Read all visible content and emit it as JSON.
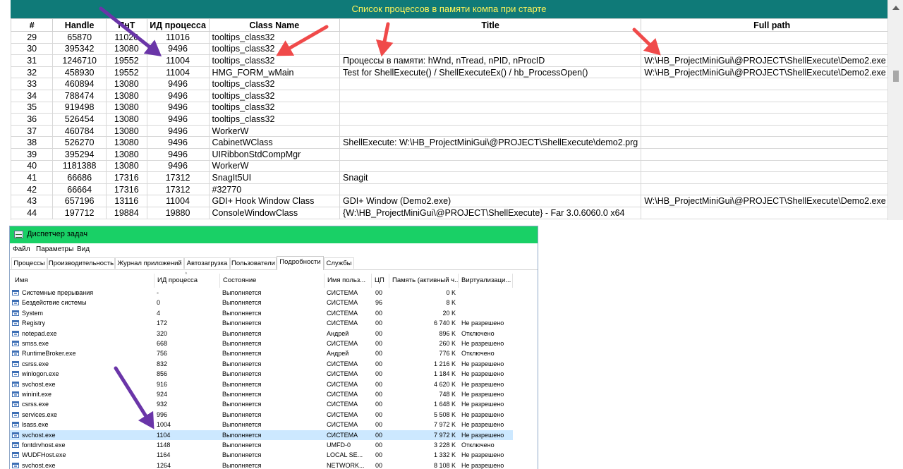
{
  "process_list": {
    "title": "Список процессов в памяти компа при старте",
    "headers": [
      "#",
      "Handle",
      "ПнТ",
      "ИД процесса",
      "Class Name",
      "Title",
      "Full path"
    ],
    "rows": [
      [
        "29",
        "65870",
        "11020",
        "11016",
        "tooltips_class32",
        "",
        ""
      ],
      [
        "30",
        "395342",
        "13080",
        "9496",
        "tooltips_class32",
        "",
        ""
      ],
      [
        "31",
        "1246710",
        "19552",
        "11004",
        "tooltips_class32",
        "Процессы в памяти: hWnd, nTread, nPID, nProcID",
        "W:\\HB_ProjectMiniGui\\@PROJECT\\ShellExecute\\Demo2.exe"
      ],
      [
        "32",
        "458930",
        "19552",
        "11004",
        "HMG_FORM_wMain",
        "Test for ShellExecute() / ShellExecuteEx() / hb_ProcessOpen()",
        "W:\\HB_ProjectMiniGui\\@PROJECT\\ShellExecute\\Demo2.exe"
      ],
      [
        "33",
        "460894",
        "13080",
        "9496",
        "tooltips_class32",
        "",
        ""
      ],
      [
        "34",
        "788474",
        "13080",
        "9496",
        "tooltips_class32",
        "",
        ""
      ],
      [
        "35",
        "919498",
        "13080",
        "9496",
        "tooltips_class32",
        "",
        ""
      ],
      [
        "36",
        "526454",
        "13080",
        "9496",
        "tooltips_class32",
        "",
        ""
      ],
      [
        "37",
        "460784",
        "13080",
        "9496",
        "WorkerW",
        "",
        ""
      ],
      [
        "38",
        "526270",
        "13080",
        "9496",
        "CabinetWClass",
        "ShellExecute: W:\\HB_ProjectMiniGui\\@PROJECT\\ShellExecute\\demo2.prg",
        ""
      ],
      [
        "39",
        "395294",
        "13080",
        "9496",
        "UIRibbonStdCompMgr",
        "",
        ""
      ],
      [
        "40",
        "1181388",
        "13080",
        "9496",
        "WorkerW",
        "",
        ""
      ],
      [
        "41",
        "66686",
        "17316",
        "17312",
        "SnagIt5UI",
        "Snagit",
        ""
      ],
      [
        "42",
        "66664",
        "17316",
        "17312",
        "#32770",
        "",
        ""
      ],
      [
        "43",
        "657196",
        "13116",
        "11004",
        "GDI+ Hook Window Class",
        "GDI+ Window (Demo2.exe)",
        "W:\\HB_ProjectMiniGui\\@PROJECT\\ShellExecute\\Demo2.exe"
      ],
      [
        "44",
        "197712",
        "19884",
        "19880",
        "ConsoleWindowClass",
        "{W:\\HB_ProjectMiniGui\\@PROJECT\\ShellExecute} - Far 3.0.6060.0 x64",
        ""
      ]
    ]
  },
  "task_manager": {
    "title": "Диспетчер задач",
    "menu": [
      "Файл",
      "Параметры",
      "Вид"
    ],
    "tabs": [
      "Процессы",
      "Производительность",
      "Журнал приложений",
      "Автозагрузка",
      "Пользователи",
      "Подробности",
      "Службы"
    ],
    "active_tab": "Подробности",
    "columns": [
      "Имя",
      "ИД процесса",
      "Состояние",
      "Имя польз...",
      "ЦП",
      "Память (активный ч...",
      "Виртуализаци..."
    ],
    "rows": [
      [
        "Системные прерывания",
        "-",
        "Выполняется",
        "СИСТЕМА",
        "00",
        "0 K",
        ""
      ],
      [
        "Бездействие системы",
        "0",
        "Выполняется",
        "СИСТЕМА",
        "96",
        "8 K",
        ""
      ],
      [
        "System",
        "4",
        "Выполняется",
        "СИСТЕМА",
        "00",
        "20 K",
        ""
      ],
      [
        "Registry",
        "172",
        "Выполняется",
        "СИСТЕМА",
        "00",
        "6 740 K",
        "Не разрешено"
      ],
      [
        "notepad.exe",
        "320",
        "Выполняется",
        "Андрей",
        "00",
        "896 K",
        "Отключено"
      ],
      [
        "smss.exe",
        "668",
        "Выполняется",
        "СИСТЕМА",
        "00",
        "260 K",
        "Не разрешено"
      ],
      [
        "RuntimeBroker.exe",
        "756",
        "Выполняется",
        "Андрей",
        "00",
        "776 K",
        "Отключено"
      ],
      [
        "csrss.exe",
        "832",
        "Выполняется",
        "СИСТЕМА",
        "00",
        "1 216 K",
        "Не разрешено"
      ],
      [
        "winlogon.exe",
        "856",
        "Выполняется",
        "СИСТЕМА",
        "00",
        "1 184 K",
        "Не разрешено"
      ],
      [
        "svchost.exe",
        "916",
        "Выполняется",
        "СИСТЕМА",
        "00",
        "4 620 K",
        "Не разрешено"
      ],
      [
        "wininit.exe",
        "924",
        "Выполняется",
        "СИСТЕМА",
        "00",
        "748 K",
        "Не разрешено"
      ],
      [
        "csrss.exe",
        "932",
        "Выполняется",
        "СИСТЕМА",
        "00",
        "1 648 K",
        "Не разрешено"
      ],
      [
        "services.exe",
        "996",
        "Выполняется",
        "СИСТЕМА",
        "00",
        "5 508 K",
        "Не разрешено"
      ],
      [
        "lsass.exe",
        "1004",
        "Выполняется",
        "СИСТЕМА",
        "00",
        "7 972 K",
        "Не разрешено"
      ],
      [
        "svchost.exe",
        "1104",
        "Выполняется",
        "СИСТЕМА",
        "00",
        "7 972 K",
        "Не разрешено"
      ],
      [
        "fontdrvhost.exe",
        "1148",
        "Выполняется",
        "UMFD-0",
        "00",
        "3 228 K",
        "Отключено"
      ],
      [
        "WUDFHost.exe",
        "1164",
        "Выполняется",
        "LOCAL SE...",
        "00",
        "1 332 K",
        "Не разрешено"
      ],
      [
        "svchost.exe",
        "1264",
        "Выполняется",
        "NETWORK...",
        "00",
        "8 108 K",
        "Не разрешено"
      ]
    ],
    "selected_row": 14
  },
  "colors": {
    "top_title_bg": "#0f7a78",
    "top_title_text": "#fff45a",
    "tm_titlebar": "#19d066",
    "arrow_red": "#f04a4a",
    "arrow_purple": "#6a35a8",
    "selection": "#cce8ff"
  }
}
